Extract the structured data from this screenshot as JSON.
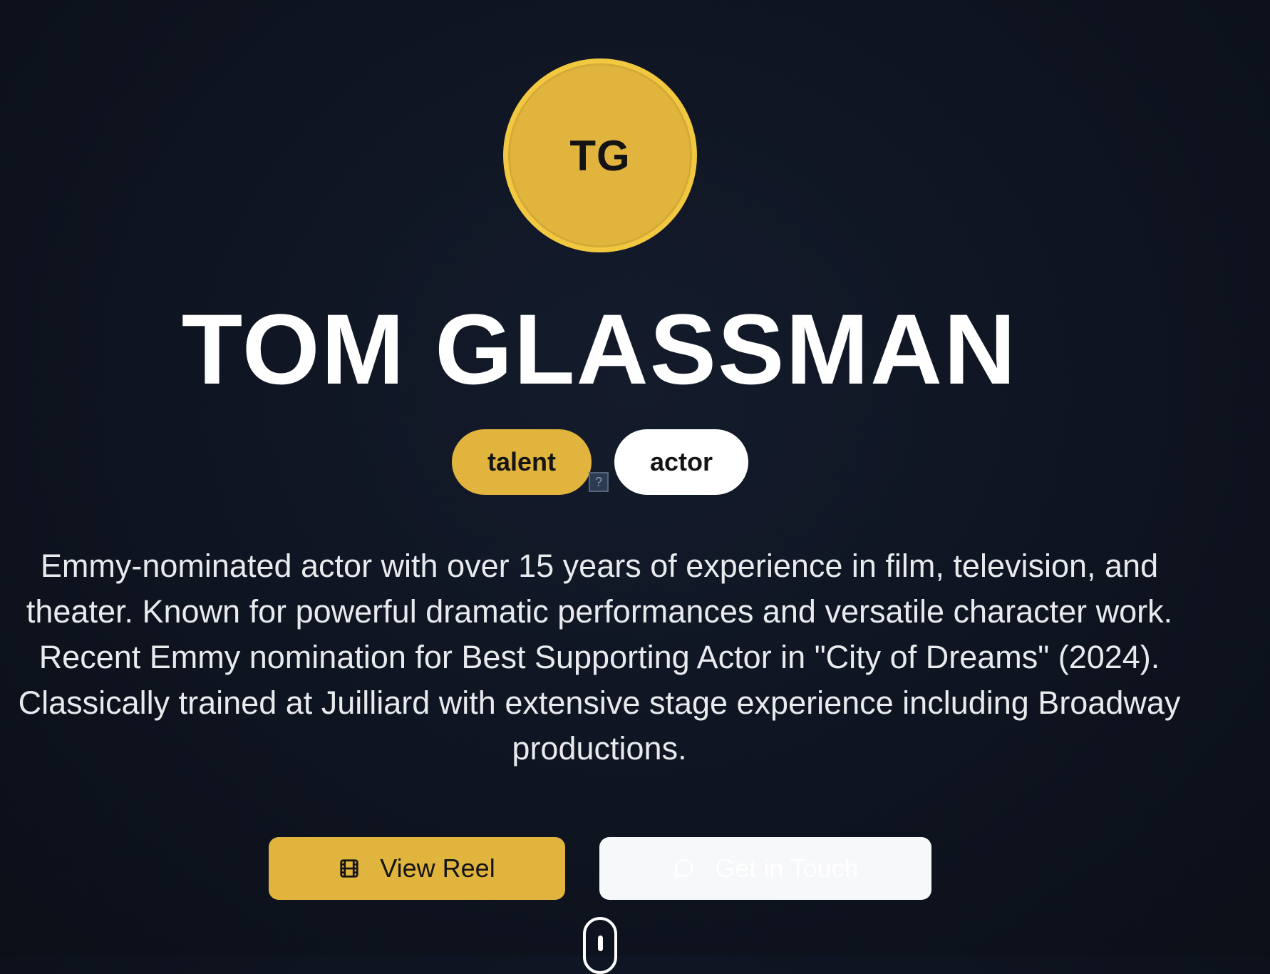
{
  "profile": {
    "initials": "TG",
    "name": "TOM GLASSMAN"
  },
  "tags": [
    {
      "label": "talent"
    },
    {
      "label": "actor"
    }
  ],
  "broken_image_glyph": "?",
  "bio": {
    "lines": [
      "Emmy-nominated actor with over 15 years of experience in film, television, and",
      "theater. Known for powerful dramatic performances and versatile character work.",
      "Recent Emmy nomination for Best Supporting Actor in \"City of Dreams\" (2024).",
      "Classically trained at Juilliard with extensive stage experience including Broadway",
      "productions."
    ]
  },
  "actions": {
    "reel_label": "View Reel",
    "reel_icon": "film-icon",
    "contact_label": "Get in Touch",
    "contact_icon": "message-circle-icon"
  },
  "colors": {
    "accent": "#e1b43e",
    "background": "#0f1522",
    "text": "#ffffff"
  }
}
